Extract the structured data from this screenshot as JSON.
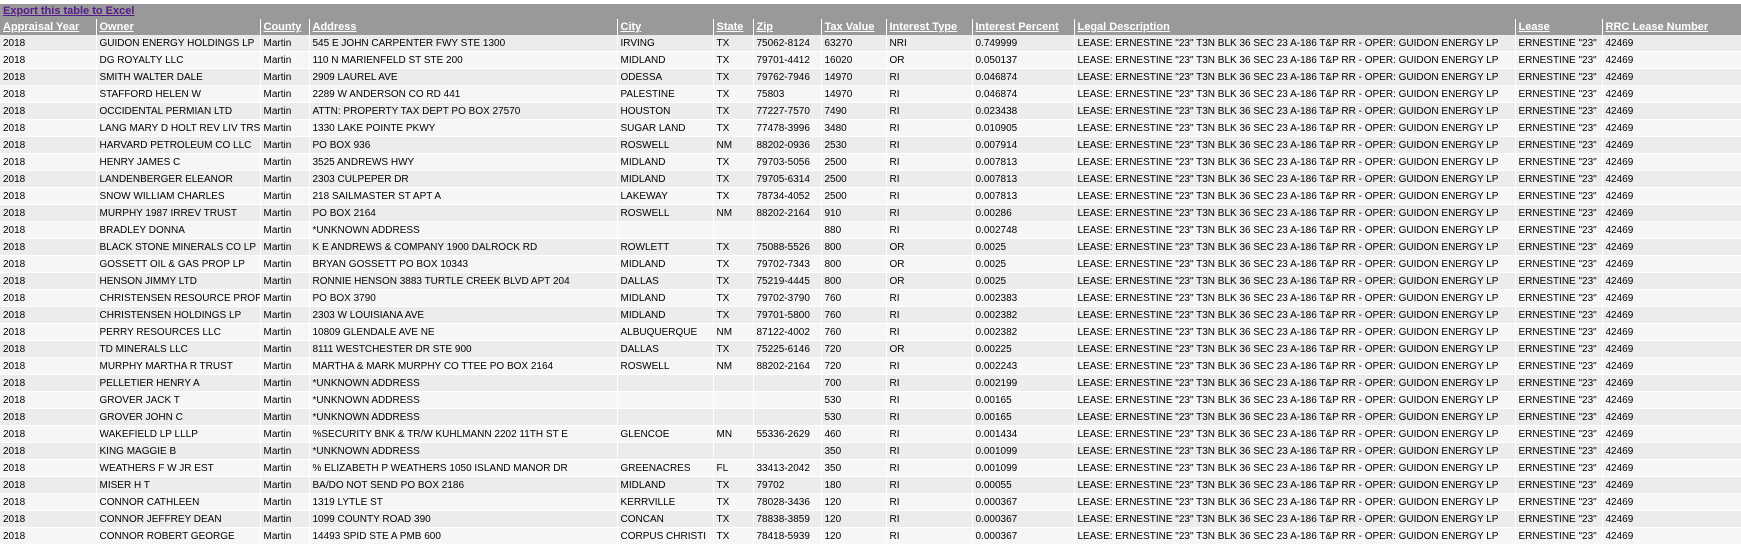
{
  "export_label": "Export this table to Excel",
  "columns": [
    "Appraisal Year",
    "Owner",
    "County",
    "Address",
    "City",
    "State",
    "Zip",
    "Tax Value",
    "Interest Type",
    "Interest Percent",
    "Legal Description",
    "Lease",
    "RRC Lease Number"
  ],
  "rows": [
    [
      "2018",
      "GUIDON ENERGY HOLDINGS LP",
      "Martin",
      "545 E JOHN CARPENTER FWY STE 1300",
      "IRVING",
      "TX",
      "75062-8124",
      "63270",
      "NRI",
      "0.749999",
      "LEASE: ERNESTINE \"23\" T3N BLK 36 SEC 23 A-186 T&P RR - OPER: GUIDON ENERGY LP",
      "ERNESTINE \"23\"",
      "42469"
    ],
    [
      "2018",
      "DG ROYALTY LLC",
      "Martin",
      "110 N MARIENFELD ST STE 200",
      "MIDLAND",
      "TX",
      "79701-4412",
      "16020",
      "OR",
      "0.050137",
      "LEASE: ERNESTINE \"23\" T3N BLK 36 SEC 23 A-186 T&P RR - OPER: GUIDON ENERGY LP",
      "ERNESTINE \"23\"",
      "42469"
    ],
    [
      "2018",
      "SMITH WALTER DALE",
      "Martin",
      "2909 LAUREL AVE",
      "ODESSA",
      "TX",
      "79762-7946",
      "14970",
      "RI",
      "0.046874",
      "LEASE: ERNESTINE \"23\" T3N BLK 36 SEC 23 A-186 T&P RR - OPER: GUIDON ENERGY LP",
      "ERNESTINE \"23\"",
      "42469"
    ],
    [
      "2018",
      "STAFFORD HELEN W",
      "Martin",
      "2289 W ANDERSON CO RD 441",
      "PALESTINE",
      "TX",
      "75803",
      "14970",
      "RI",
      "0.046874",
      "LEASE: ERNESTINE \"23\" T3N BLK 36 SEC 23 A-186 T&P RR - OPER: GUIDON ENERGY LP",
      "ERNESTINE \"23\"",
      "42469"
    ],
    [
      "2018",
      "OCCIDENTAL PERMIAN LTD",
      "Martin",
      "ATTN: PROPERTY TAX DEPT PO BOX 27570",
      "HOUSTON",
      "TX",
      "77227-7570",
      "7490",
      "RI",
      "0.023438",
      "LEASE: ERNESTINE \"23\" T3N BLK 36 SEC 23 A-186 T&P RR - OPER: GUIDON ENERGY LP",
      "ERNESTINE \"23\"",
      "42469"
    ],
    [
      "2018",
      "LANG MARY D HOLT REV LIV TRST",
      "Martin",
      "1330 LAKE POINTE PKWY",
      "SUGAR LAND",
      "TX",
      "77478-3996",
      "3480",
      "RI",
      "0.010905",
      "LEASE: ERNESTINE \"23\" T3N BLK 36 SEC 23 A-186 T&P RR - OPER: GUIDON ENERGY LP",
      "ERNESTINE \"23\"",
      "42469"
    ],
    [
      "2018",
      "HARVARD PETROLEUM CO LLC",
      "Martin",
      "PO BOX 936",
      "ROSWELL",
      "NM",
      "88202-0936",
      "2530",
      "RI",
      "0.007914",
      "LEASE: ERNESTINE \"23\" T3N BLK 36 SEC 23 A-186 T&P RR - OPER: GUIDON ENERGY LP",
      "ERNESTINE \"23\"",
      "42469"
    ],
    [
      "2018",
      "HENRY JAMES C",
      "Martin",
      "3525 ANDREWS HWY",
      "MIDLAND",
      "TX",
      "79703-5056",
      "2500",
      "RI",
      "0.007813",
      "LEASE: ERNESTINE \"23\" T3N BLK 36 SEC 23 A-186 T&P RR - OPER: GUIDON ENERGY LP",
      "ERNESTINE \"23\"",
      "42469"
    ],
    [
      "2018",
      "LANDENBERGER ELEANOR",
      "Martin",
      "2303 CULPEPER DR",
      "MIDLAND",
      "TX",
      "79705-6314",
      "2500",
      "RI",
      "0.007813",
      "LEASE: ERNESTINE \"23\" T3N BLK 36 SEC 23 A-186 T&P RR - OPER: GUIDON ENERGY LP",
      "ERNESTINE \"23\"",
      "42469"
    ],
    [
      "2018",
      "SNOW WILLIAM CHARLES",
      "Martin",
      "218 SAILMASTER ST APT A",
      "LAKEWAY",
      "TX",
      "78734-4052",
      "2500",
      "RI",
      "0.007813",
      "LEASE: ERNESTINE \"23\" T3N BLK 36 SEC 23 A-186 T&P RR - OPER: GUIDON ENERGY LP",
      "ERNESTINE \"23\"",
      "42469"
    ],
    [
      "2018",
      "MURPHY 1987 IRREV TRUST",
      "Martin",
      "PO BOX 2164",
      "ROSWELL",
      "NM",
      "88202-2164",
      "910",
      "RI",
      "0.00286",
      "LEASE: ERNESTINE \"23\" T3N BLK 36 SEC 23 A-186 T&P RR - OPER: GUIDON ENERGY LP",
      "ERNESTINE \"23\"",
      "42469"
    ],
    [
      "2018",
      "BRADLEY DONNA",
      "Martin",
      "*UNKNOWN ADDRESS",
      "",
      "",
      "",
      "880",
      "RI",
      "0.002748",
      "LEASE: ERNESTINE \"23\" T3N BLK 36 SEC 23 A-186 T&P RR - OPER: GUIDON ENERGY LP",
      "ERNESTINE \"23\"",
      "42469"
    ],
    [
      "2018",
      "BLACK STONE MINERALS CO LP",
      "Martin",
      "K E ANDREWS & COMPANY 1900 DALROCK RD",
      "ROWLETT",
      "TX",
      "75088-5526",
      "800",
      "OR",
      "0.0025",
      "LEASE: ERNESTINE \"23\" T3N BLK 36 SEC 23 A-186 T&P RR - OPER: GUIDON ENERGY LP",
      "ERNESTINE \"23\"",
      "42469"
    ],
    [
      "2018",
      "GOSSETT OIL & GAS PROP LP",
      "Martin",
      "BRYAN GOSSETT PO BOX 10343",
      "MIDLAND",
      "TX",
      "79702-7343",
      "800",
      "OR",
      "0.0025",
      "LEASE: ERNESTINE \"23\" T3N BLK 36 SEC 23 A-186 T&P RR - OPER: GUIDON ENERGY LP",
      "ERNESTINE \"23\"",
      "42469"
    ],
    [
      "2018",
      "HENSON JIMMY LTD",
      "Martin",
      "RONNIE HENSON 3883 TURTLE CREEK BLVD APT 204",
      "DALLAS",
      "TX",
      "75219-4445",
      "800",
      "OR",
      "0.0025",
      "LEASE: ERNESTINE \"23\" T3N BLK 36 SEC 23 A-186 T&P RR - OPER: GUIDON ENERGY LP",
      "ERNESTINE \"23\"",
      "42469"
    ],
    [
      "2018",
      "CHRISTENSEN RESOURCE PROP LP",
      "Martin",
      "PO BOX 3790",
      "MIDLAND",
      "TX",
      "79702-3790",
      "760",
      "RI",
      "0.002383",
      "LEASE: ERNESTINE \"23\" T3N BLK 36 SEC 23 A-186 T&P RR - OPER: GUIDON ENERGY LP",
      "ERNESTINE \"23\"",
      "42469"
    ],
    [
      "2018",
      "CHRISTENSEN HOLDINGS LP",
      "Martin",
      "2303 W LOUISIANA AVE",
      "MIDLAND",
      "TX",
      "79701-5800",
      "760",
      "RI",
      "0.002382",
      "LEASE: ERNESTINE \"23\" T3N BLK 36 SEC 23 A-186 T&P RR - OPER: GUIDON ENERGY LP",
      "ERNESTINE \"23\"",
      "42469"
    ],
    [
      "2018",
      "PERRY RESOURCES LLC",
      "Martin",
      "10809 GLENDALE AVE NE",
      "ALBUQUERQUE",
      "NM",
      "87122-4002",
      "760",
      "RI",
      "0.002382",
      "LEASE: ERNESTINE \"23\" T3N BLK 36 SEC 23 A-186 T&P RR - OPER: GUIDON ENERGY LP",
      "ERNESTINE \"23\"",
      "42469"
    ],
    [
      "2018",
      "TD MINERALS LLC",
      "Martin",
      "8111 WESTCHESTER DR STE 900",
      "DALLAS",
      "TX",
      "75225-6146",
      "720",
      "OR",
      "0.00225",
      "LEASE: ERNESTINE \"23\" T3N BLK 36 SEC 23 A-186 T&P RR - OPER: GUIDON ENERGY LP",
      "ERNESTINE \"23\"",
      "42469"
    ],
    [
      "2018",
      "MURPHY MARTHA R TRUST",
      "Martin",
      "MARTHA & MARK MURPHY CO TTEE PO BOX 2164",
      "ROSWELL",
      "NM",
      "88202-2164",
      "720",
      "RI",
      "0.002243",
      "LEASE: ERNESTINE \"23\" T3N BLK 36 SEC 23 A-186 T&P RR - OPER: GUIDON ENERGY LP",
      "ERNESTINE \"23\"",
      "42469"
    ],
    [
      "2018",
      "PELLETIER HENRY A",
      "Martin",
      "*UNKNOWN ADDRESS",
      "",
      "",
      "",
      "700",
      "RI",
      "0.002199",
      "LEASE: ERNESTINE \"23\" T3N BLK 36 SEC 23 A-186 T&P RR - OPER: GUIDON ENERGY LP",
      "ERNESTINE \"23\"",
      "42469"
    ],
    [
      "2018",
      "GROVER JACK T",
      "Martin",
      "*UNKNOWN ADDRESS",
      "",
      "",
      "",
      "530",
      "RI",
      "0.00165",
      "LEASE: ERNESTINE \"23\" T3N BLK 36 SEC 23 A-186 T&P RR - OPER: GUIDON ENERGY LP",
      "ERNESTINE \"23\"",
      "42469"
    ],
    [
      "2018",
      "GROVER JOHN C",
      "Martin",
      "*UNKNOWN ADDRESS",
      "",
      "",
      "",
      "530",
      "RI",
      "0.00165",
      "LEASE: ERNESTINE \"23\" T3N BLK 36 SEC 23 A-186 T&P RR - OPER: GUIDON ENERGY LP",
      "ERNESTINE \"23\"",
      "42469"
    ],
    [
      "2018",
      "WAKEFIELD LP LLLP",
      "Martin",
      "%SECURITY BNK & TR/W KUHLMANN 2202 11TH ST E",
      "GLENCOE",
      "MN",
      "55336-2629",
      "460",
      "RI",
      "0.001434",
      "LEASE: ERNESTINE \"23\" T3N BLK 36 SEC 23 A-186 T&P RR - OPER: GUIDON ENERGY LP",
      "ERNESTINE \"23\"",
      "42469"
    ],
    [
      "2018",
      "KING MAGGIE B",
      "Martin",
      "*UNKNOWN ADDRESS",
      "",
      "",
      "",
      "350",
      "RI",
      "0.001099",
      "LEASE: ERNESTINE \"23\" T3N BLK 36 SEC 23 A-186 T&P RR - OPER: GUIDON ENERGY LP",
      "ERNESTINE \"23\"",
      "42469"
    ],
    [
      "2018",
      "WEATHERS F W JR EST",
      "Martin",
      "% ELIZABETH P WEATHERS 1050 ISLAND MANOR DR",
      "GREENACRES",
      "FL",
      "33413-2042",
      "350",
      "RI",
      "0.001099",
      "LEASE: ERNESTINE \"23\" T3N BLK 36 SEC 23 A-186 T&P RR - OPER: GUIDON ENERGY LP",
      "ERNESTINE \"23\"",
      "42469"
    ],
    [
      "2018",
      "MISER H T",
      "Martin",
      "BA/DO NOT SEND PO BOX 2186",
      "MIDLAND",
      "TX",
      "79702",
      "180",
      "RI",
      "0.00055",
      "LEASE: ERNESTINE \"23\" T3N BLK 36 SEC 23 A-186 T&P RR - OPER: GUIDON ENERGY LP",
      "ERNESTINE \"23\"",
      "42469"
    ],
    [
      "2018",
      "CONNOR CATHLEEN",
      "Martin",
      "1319 LYTLE ST",
      "KERRVILLE",
      "TX",
      "78028-3436",
      "120",
      "RI",
      "0.000367",
      "LEASE: ERNESTINE \"23\" T3N BLK 36 SEC 23 A-186 T&P RR - OPER: GUIDON ENERGY LP",
      "ERNESTINE \"23\"",
      "42469"
    ],
    [
      "2018",
      "CONNOR JEFFREY DEAN",
      "Martin",
      "1099 COUNTY ROAD 390",
      "CONCAN",
      "TX",
      "78838-3859",
      "120",
      "RI",
      "0.000367",
      "LEASE: ERNESTINE \"23\" T3N BLK 36 SEC 23 A-186 T&P RR - OPER: GUIDON ENERGY LP",
      "ERNESTINE \"23\"",
      "42469"
    ],
    [
      "2018",
      "CONNOR ROBERT GEORGE",
      "Martin",
      "14493 SPID STE A PMB 600",
      "CORPUS CHRISTI",
      "TX",
      "78418-5939",
      "120",
      "RI",
      "0.000367",
      "LEASE: ERNESTINE \"23\" T3N BLK 36 SEC 23 A-186 T&P RR - OPER: GUIDON ENERGY LP",
      "ERNESTINE \"23\"",
      "42469"
    ]
  ]
}
